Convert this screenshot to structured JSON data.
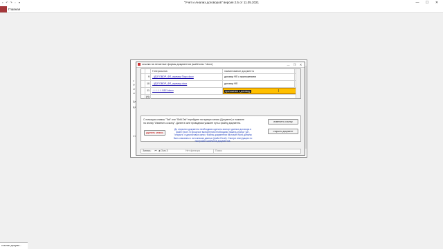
{
  "app": {
    "title": "\"Учет и Анализ договоров\" версия 2.5 от 11.05.2021",
    "ribbon_home_tab": "Главная",
    "qat_icons": [
      "save-icon",
      "undo-icon",
      "redo-icon",
      "print-icon",
      "customize-icon"
    ],
    "window_controls": {
      "minimize": "—",
      "maximize": "☐",
      "close": "✕"
    },
    "taskbar_tab": "ссылки докуме..."
  },
  "background_form": {
    "side_labels": [
      "с",
      "Ф",
      "ст",
      "ст",
      "Да",
      "Дз",
      "Ст"
    ]
  },
  "dialog": {
    "title": "ссылки на печатные формы документов (шаблоны *.docx)",
    "controls": {
      "minimize": "—",
      "restore": "❐",
      "close": "✕"
    },
    "columns": {
      "link": "Гиперссылка",
      "name": "наименование документа"
    },
    "rows": [
      {
        "id": "9",
        "link": "..\\ДОГОВОР_ФЛ_пример Поро.docx",
        "name": "договор ФЛ с приложением"
      },
      {
        "id": "10",
        "link": "..\\ДОГОВОР_ФЛ_пример.docx",
        "name": "договор ФЛ"
      },
      {
        "id": "11",
        "link": "..\\..\\..\\..\\..\\1111.docx",
        "name": "приложение к договору"
      }
    ],
    "new_row_marker": "(N)",
    "hint_text": "С помощью клавиш \"Tab\" или \"Shift-Tab\" перейдите на нужную запись (Документ) и нажмите на кнопку \"Изменить ссылку\". Далее в окне проводника укажите путь к файлу документа.",
    "hint_text_blue": "До открытия документа необходимо сделать экспорт данных договора в файл Excel. В процессе выполнения необходимо нажать кнопки \"да\", \"открыть\" в диалоговых окнах. Файлы документов Microsoft Word должны быть связанны с источником данных (файл Excel). Смотри инструкцию по настройке шаблонов документов.",
    "buttons": {
      "create_link": "изменить ссылку",
      "open_document": "открыть документ",
      "delete_record": "удалить запись"
    },
    "nav": {
      "label": "Запись:",
      "position": "3 из 3",
      "filter": "Нет фильтра",
      "search": "Поиск"
    }
  },
  "colors": {
    "access_accent": "#a4373a",
    "combo_highlight": "#ffc000",
    "hyperlink": "#1a0dab",
    "delete_red": "#c00000"
  }
}
